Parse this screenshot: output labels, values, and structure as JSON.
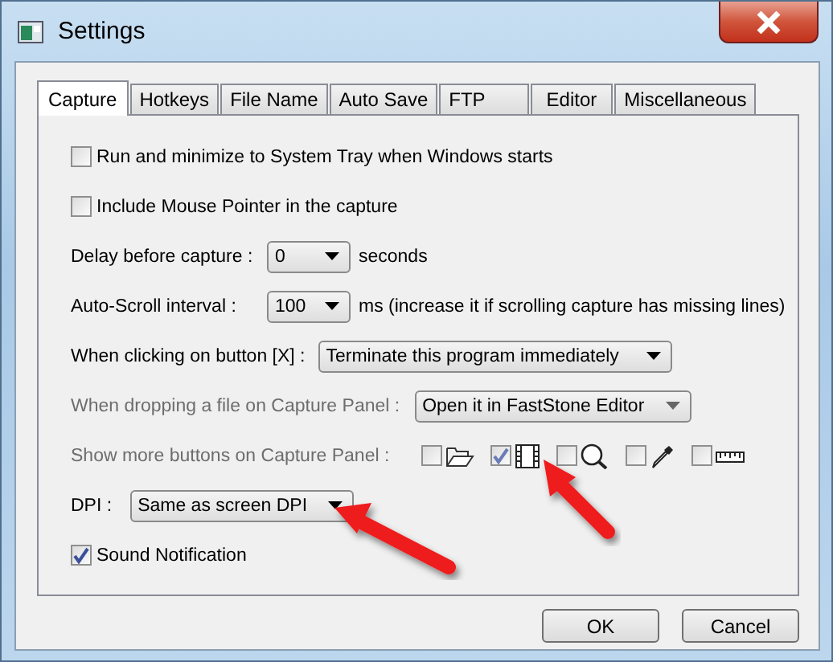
{
  "window": {
    "title": "Settings"
  },
  "tabs": [
    {
      "label": "Capture",
      "selected": true
    },
    {
      "label": "Hotkeys",
      "selected": false
    },
    {
      "label": "File Name",
      "selected": false
    },
    {
      "label": "Auto Save",
      "selected": false
    },
    {
      "label": "FTP",
      "selected": false
    },
    {
      "label": "Editor",
      "selected": false
    },
    {
      "label": "Miscellaneous",
      "selected": false
    }
  ],
  "options": [
    {
      "kind": "checkbox",
      "label": "Run and minimize to System Tray when Windows starts",
      "checked": false
    },
    {
      "kind": "checkbox",
      "label": "Include Mouse Pointer in the capture",
      "checked": false
    },
    {
      "kind": "dropdown",
      "label": "Delay before capture :",
      "value": "0",
      "suffix": "seconds",
      "disabled": false
    },
    {
      "kind": "dropdown",
      "label": "Auto-Scroll interval :",
      "value": "100",
      "suffix": "ms (increase it if scrolling capture has missing lines)",
      "disabled": false
    },
    {
      "kind": "dropdown",
      "label": "When clicking on button [X] :",
      "value": "Terminate this program immediately",
      "disabled": false
    },
    {
      "kind": "dropdown",
      "label": "When dropping a file on Capture Panel :",
      "value": "Open it in FastStone Editor",
      "disabled": true
    },
    {
      "kind": "iconchecks",
      "label": "Show more buttons on Capture Panel :",
      "disabled": true,
      "items": [
        {
          "checked": false
        },
        {
          "checked": true
        },
        {
          "checked": false
        },
        {
          "checked": false
        },
        {
          "checked": false
        }
      ]
    },
    {
      "kind": "dropdown",
      "label": "DPI :",
      "value": "Same as screen DPI",
      "disabled": false
    },
    {
      "kind": "checkbox",
      "label": "Sound Notification",
      "checked": true
    }
  ],
  "buttons": [
    "OK",
    "Cancel"
  ]
}
